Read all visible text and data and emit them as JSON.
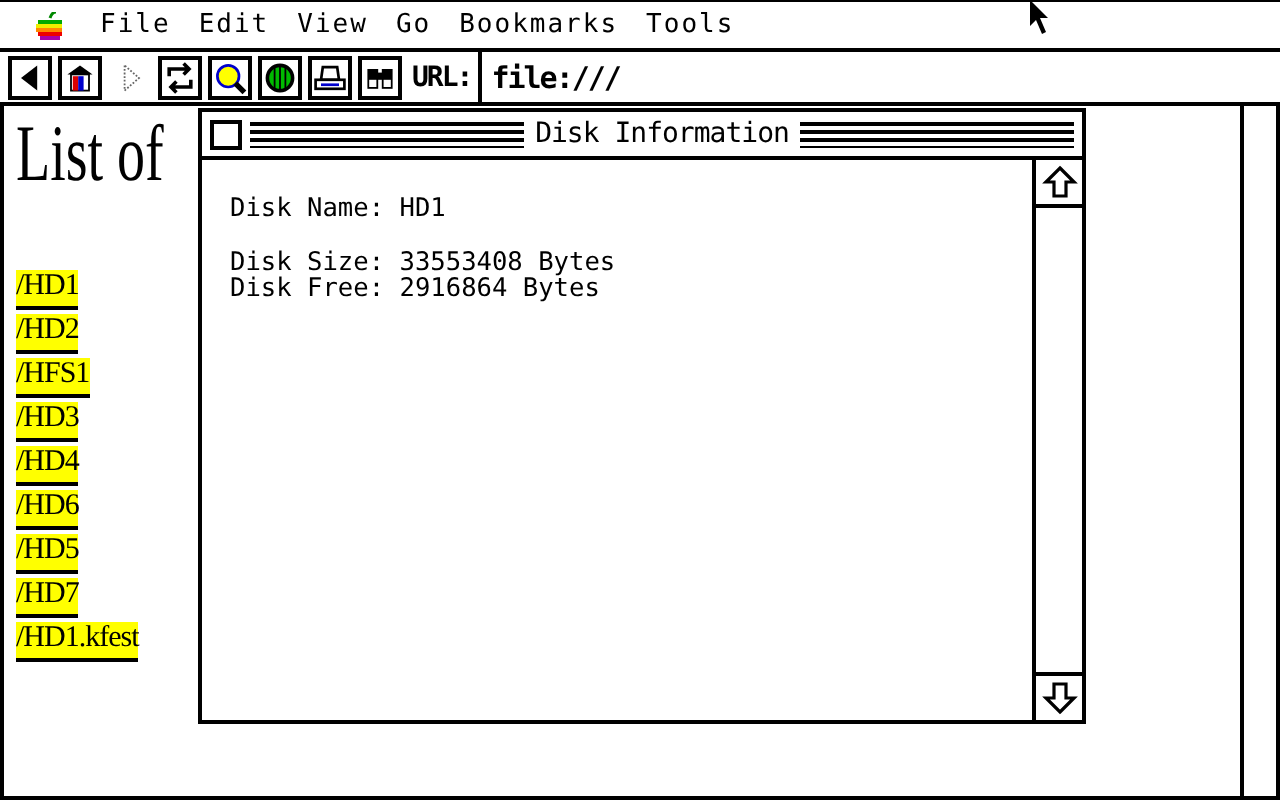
{
  "menu_bar": {
    "items": [
      "File",
      "Edit",
      "View",
      "Go",
      "Bookmarks",
      "Tools"
    ]
  },
  "toolbar": {
    "buttons": [
      {
        "kind": "back",
        "disabled": false
      },
      {
        "kind": "home",
        "disabled": false
      },
      {
        "kind": "forward",
        "disabled": true
      },
      {
        "kind": "reload",
        "disabled": false
      },
      {
        "kind": "search",
        "disabled": false
      },
      {
        "kind": "globe",
        "disabled": false
      },
      {
        "kind": "print",
        "disabled": false
      },
      {
        "kind": "find",
        "disabled": false
      }
    ],
    "url_label": "URL:",
    "url": "file:///"
  },
  "page": {
    "heading": "List of",
    "links": [
      "/HD1",
      "/HD2",
      "/HFS1",
      "/HD3",
      "/HD4",
      "/HD6",
      "/HD5",
      "/HD7",
      "/HD1.kfest"
    ]
  },
  "dialog": {
    "title": "Disk Information",
    "paragraphs": [
      {
        "lines": [
          "Disk Name: HD1"
        ]
      },
      {
        "lines": [
          "Disk Size: 33553408 Bytes",
          "Disk Free: 2916864 Bytes"
        ]
      }
    ]
  }
}
